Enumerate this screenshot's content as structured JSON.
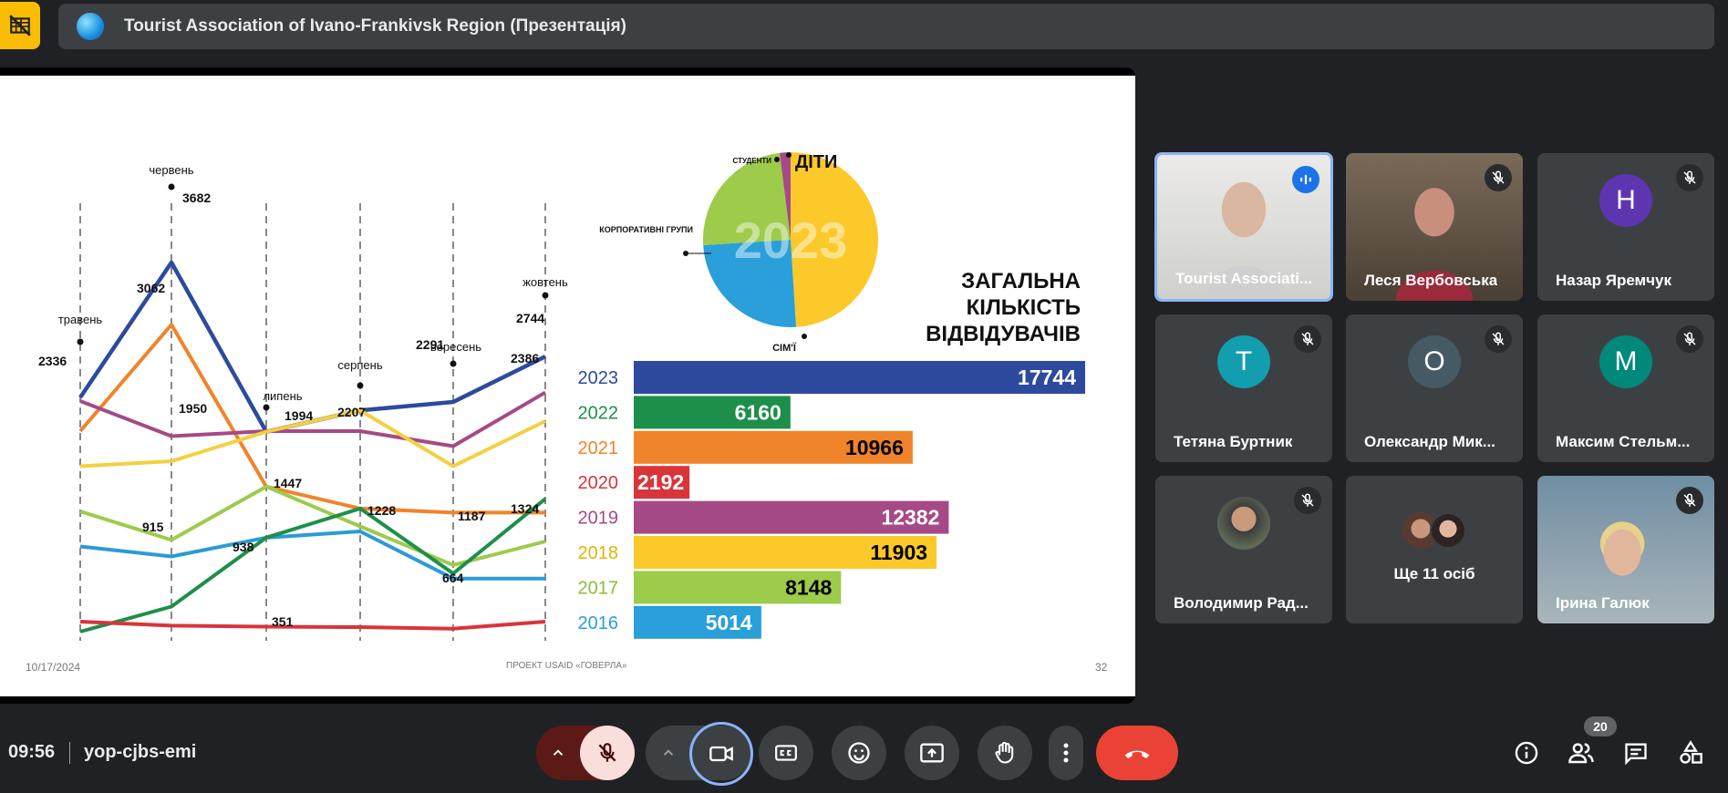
{
  "window": {
    "title": "Tourist Association of Ivano-Frankivsk Region (Презентація)"
  },
  "slide": {
    "date": "10/17/2024",
    "project": "ПРОЕКТ USAID «ГОВЕРЛА»",
    "page": "32",
    "heading_lines": [
      "ЗАГАЛЬНА",
      "КІЛЬКІСТЬ",
      "ВІДВІДУВАЧІВ"
    ],
    "pie_year": "2023"
  },
  "chart_data": [
    {
      "type": "line",
      "categories": [
        "травень",
        "червень",
        "липень",
        "серпень",
        "вересень",
        "жовтень"
      ],
      "series": [
        {
          "color": "#2e4a9e",
          "values": [
            2336,
            3682,
            1994,
            2207,
            2291,
            2744
          ]
        },
        {
          "color": "#f0842a",
          "values": [
            2000,
            3062,
            1447,
            1228,
            1187,
            1187
          ]
        },
        {
          "color": "#a54a86",
          "values": [
            2300,
            1950,
            2000,
            2000,
            1850,
            2386
          ]
        },
        {
          "color": "#f4d03f",
          "values": [
            1650,
            1700,
            1994,
            2207,
            1650,
            2100
          ]
        },
        {
          "color": "#9dcb4a",
          "values": [
            1200,
            915,
            1447,
            1050,
            664,
            900
          ]
        },
        {
          "color": "#2b9bd6",
          "values": [
            850,
            750,
            938,
            1000,
            530,
            530
          ]
        },
        {
          "color": "#1e8f4a",
          "values": [
            0,
            250,
            938,
            1228,
            580,
            1324
          ]
        },
        {
          "color": "#d9343a",
          "values": [
            100,
            60,
            50,
            45,
            30,
            100
          ]
        }
      ],
      "labels": [
        {
          "text": "2336",
          "cat": 0
        },
        {
          "text": "3682",
          "cat": 1
        },
        {
          "text": "3062",
          "cat": 1
        },
        {
          "text": "1950",
          "cat": 1
        },
        {
          "text": "915",
          "cat": 1
        },
        {
          "text": "1994",
          "cat": 2
        },
        {
          "text": "1447",
          "cat": 2
        },
        {
          "text": "938",
          "cat": 2
        },
        {
          "text": "351",
          "cat": 2
        },
        {
          "text": "2207",
          "cat": 3
        },
        {
          "text": "1228",
          "cat": 3
        },
        {
          "text": "2291",
          "cat": 4
        },
        {
          "text": "1187",
          "cat": 4
        },
        {
          "text": "664",
          "cat": 4
        },
        {
          "text": "2744",
          "cat": 5
        },
        {
          "text": "2386",
          "cat": 5
        },
        {
          "text": "1324",
          "cat": 5
        }
      ]
    },
    {
      "type": "pie",
      "slices": [
        {
          "label": "ДІТИ",
          "value": 49,
          "color": "#fcc92a"
        },
        {
          "label": "СІМ'Ї",
          "value": 25,
          "color": "#2a9fd9"
        },
        {
          "label": "КОРПОРАТИВНІ ГРУПИ",
          "value": 24,
          "color": "#9dcb4a"
        },
        {
          "label": "СТУДЕНТИ",
          "value": 2,
          "color": "#a54a86"
        }
      ]
    },
    {
      "type": "bar",
      "categories": [
        "2023",
        "2022",
        "2021",
        "2020",
        "2019",
        "2018",
        "2017",
        "2016"
      ],
      "values": [
        17744,
        6160,
        10966,
        2192,
        12382,
        11903,
        8148,
        5014
      ],
      "colors": [
        "#2e4a9e",
        "#1e8f4a",
        "#f0842a",
        "#d9343a",
        "#a54a86",
        "#fcc92a",
        "#9dcb4a",
        "#2a9fd9"
      ],
      "label_colors": [
        "#2e4a9e",
        "#1e8f4a",
        "#f0842a",
        "#d9343a",
        "#a54a86",
        "#e6b400",
        "#8fbb38",
        "#2a9fd9"
      ],
      "value_text_colors": [
        "#ffffff",
        "#ffffff",
        "#000000",
        "#ffffff",
        "#ffffff",
        "#000000",
        "#000000",
        "#ffffff"
      ]
    }
  ],
  "participants": [
    {
      "name": "Tourist Associati...",
      "type": "photo",
      "speaking": true,
      "muted": false
    },
    {
      "name": "Леся Вербовська",
      "type": "photo",
      "muted": true
    },
    {
      "name": "Назар Яремчук",
      "type": "initial",
      "initial": "Н",
      "color": "#5e35b1",
      "muted": true
    },
    {
      "name": "Тетяна Буртник",
      "type": "initial",
      "initial": "T",
      "color": "#129eaf",
      "muted": true
    },
    {
      "name": "Олександр Мик...",
      "type": "initial",
      "initial": "O",
      "color": "#455a64",
      "muted": true
    },
    {
      "name": "Максим Стельм...",
      "type": "initial",
      "initial": "M",
      "color": "#00897b",
      "muted": true
    },
    {
      "name": "Володимир Рад...",
      "type": "avatar-photo",
      "muted": true
    },
    {
      "name": "Ще 11 осіб",
      "type": "more"
    },
    {
      "name": "Ірина Галюк",
      "type": "photo",
      "muted": true
    }
  ],
  "bottom": {
    "time": "09:56",
    "meeting_code": "yop-cjbs-emi",
    "participants_count": "20"
  }
}
